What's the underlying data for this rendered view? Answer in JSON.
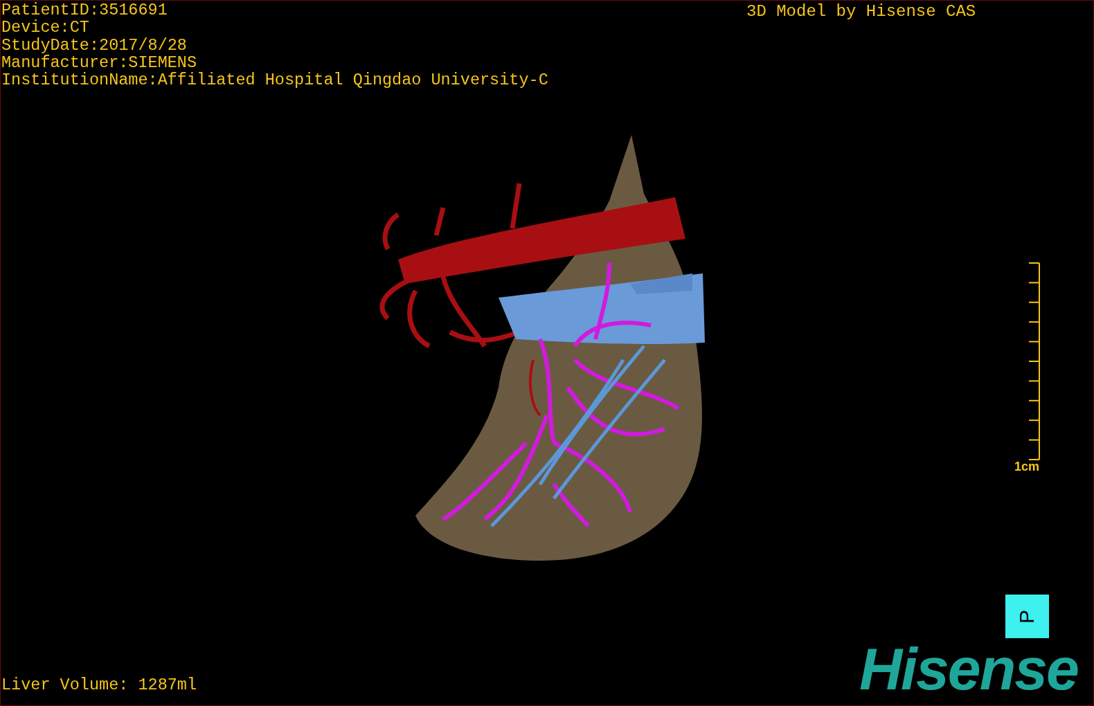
{
  "patient_info": [
    "PatientID:3516691",
    "Device:CT",
    "StudyDate:2017/8/28",
    "Manufacturer:SIEMENS",
    "InstitutionName:Affiliated Hospital Qingdao University-C"
  ],
  "model_credit": "3D Model by Hisense CAS",
  "scale_bar": {
    "label": "1cm"
  },
  "orientation_marker": "P",
  "liver_volume": "Liver Volume: 1287ml",
  "logo": "Hisense"
}
